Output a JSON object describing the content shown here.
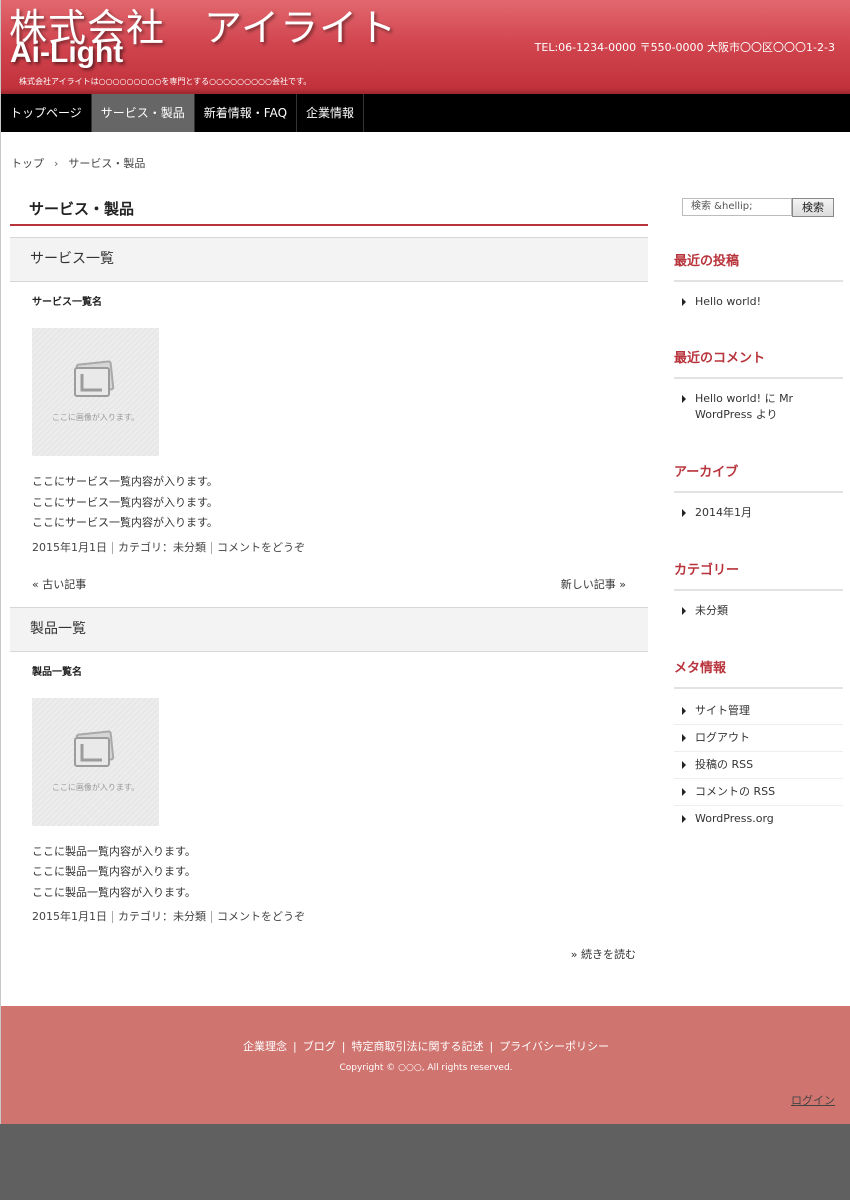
{
  "header": {
    "title_jp": "株式会社　アイライト",
    "title_en": "Ai-Light",
    "tagline": "株式会社アイライトは○○○○○○○○○を専門とする○○○○○○○○○会社です。",
    "contact": "TEL:06-1234-0000 〒550-0000 大阪市〇〇区〇〇〇1-2-3"
  },
  "nav": {
    "items": [
      {
        "label": "トップページ"
      },
      {
        "label": "サービス・製品"
      },
      {
        "label": "新着情報・FAQ"
      },
      {
        "label": "企業情報"
      }
    ],
    "active": "サービス・製品"
  },
  "breadcrumb": {
    "home": "トップ",
    "separator": "›",
    "current": "サービス・製品"
  },
  "main": {
    "page_title": "サービス・製品",
    "sections": [
      {
        "heading": "サービス一覧",
        "post_title": "サービス一覧名",
        "image_label": "ここに画像が入ります。",
        "body": [
          "ここにサービス一覧内容が入ります。",
          "ここにサービス一覧内容が入ります。",
          "ここにサービス一覧内容が入ります。"
        ],
        "date": "2015年1月1日",
        "category": "カテゴリ：未分類",
        "comments": "コメントをどうぞ"
      },
      {
        "heading": "製品一覧",
        "post_title": "製品一覧名",
        "image_label": "ここに画像が入ります。",
        "body": [
          "ここに製品一覧内容が入ります。",
          "ここに製品一覧内容が入ります。",
          "ここに製品一覧内容が入ります。"
        ],
        "date": "2015年1月1日",
        "category": "カテゴリ：未分類",
        "comments": "コメントをどうぞ"
      }
    ],
    "pager": {
      "older": "« 古い記事",
      "newer": "新しい記事 »"
    },
    "read_more": "» 続きを読む"
  },
  "sidebar": {
    "search": {
      "placeholder": "検索 &hellip;",
      "button": "検索"
    },
    "recent_posts": {
      "title": "最近の投稿",
      "items": [
        "Hello world!"
      ]
    },
    "recent_comments": {
      "title": "最近のコメント",
      "line1": "Hello world! に Mr",
      "line2": "WordPress より"
    },
    "archives": {
      "title": "アーカイブ",
      "items": [
        "2014年1月"
      ]
    },
    "categories": {
      "title": "カテゴリー",
      "items": [
        "未分類"
      ]
    },
    "meta": {
      "title": "メタ情報",
      "items": [
        "サイト管理",
        "ログアウト",
        "投稿の RSS",
        "コメントの RSS",
        "WordPress.org"
      ]
    }
  },
  "footer": {
    "links": [
      "企業理念",
      "ブログ",
      "特定商取引法に関する記述",
      "プライバシーポリシー"
    ],
    "separator": "|",
    "copyright": "Copyright © ○○○, All rights reserved.",
    "login": "ログイン"
  },
  "colors": {
    "accent": "#b8343c",
    "header": "#d24650",
    "footer": "#d07470",
    "nav": "#000000"
  }
}
